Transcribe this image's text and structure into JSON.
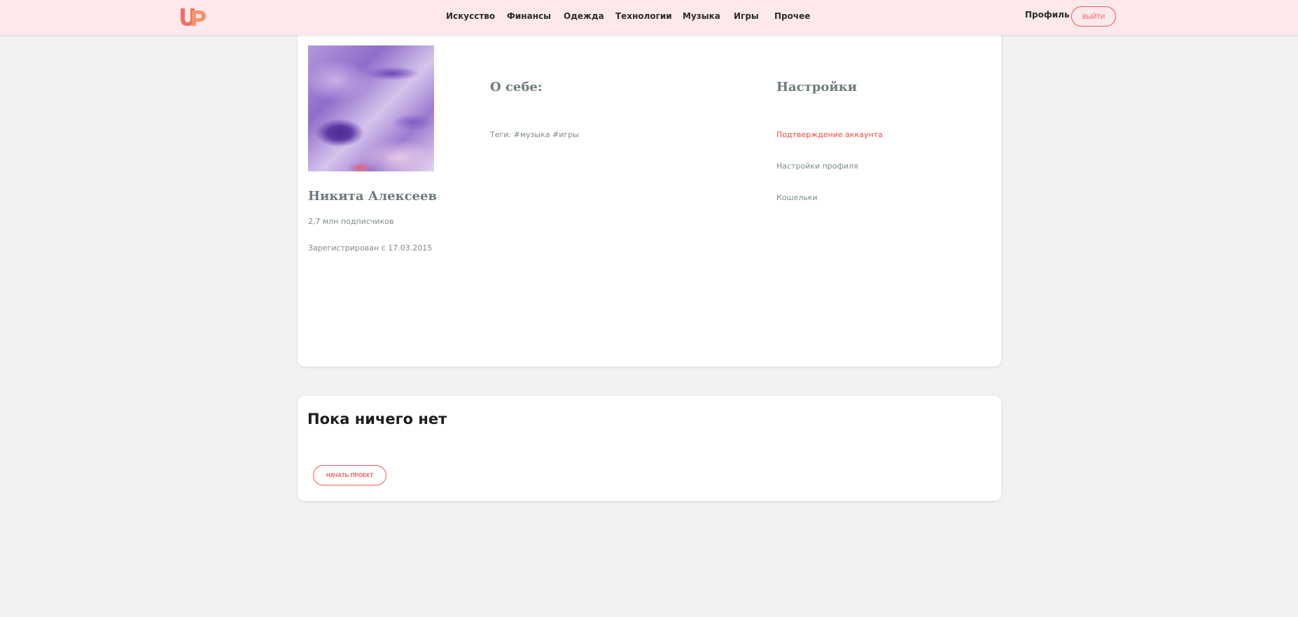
{
  "colors": {
    "header_bg": "#fde8ec",
    "accent": "#f04848",
    "page_bg": "#f2f2f2"
  },
  "header": {
    "logo_icon": "up-logo",
    "nav": [
      {
        "label": "Искусство"
      },
      {
        "label": "Финансы"
      },
      {
        "label": "Одежда"
      },
      {
        "label": "Технологии"
      },
      {
        "label": "Музыка"
      },
      {
        "label": "Игры"
      },
      {
        "label": "Прочее"
      }
    ],
    "profile_label": "Профиль",
    "logout_label": "выйти"
  },
  "profile": {
    "name": "Никита Алексеев",
    "subscribers": "2,7 млн подписчиков",
    "registered": "Зарегистрирован с 17.03.2015",
    "about_title": "О себе:",
    "tags": "Теги: #музыка #игры",
    "settings_title": "Настройки",
    "settings_links": [
      {
        "label": "Подтверждение аккаунта"
      },
      {
        "label": "Настройки профиля"
      },
      {
        "label": "Кошельки"
      }
    ]
  },
  "projects": {
    "empty_title": "Пока ничего нет",
    "start_label": "начать проект"
  }
}
